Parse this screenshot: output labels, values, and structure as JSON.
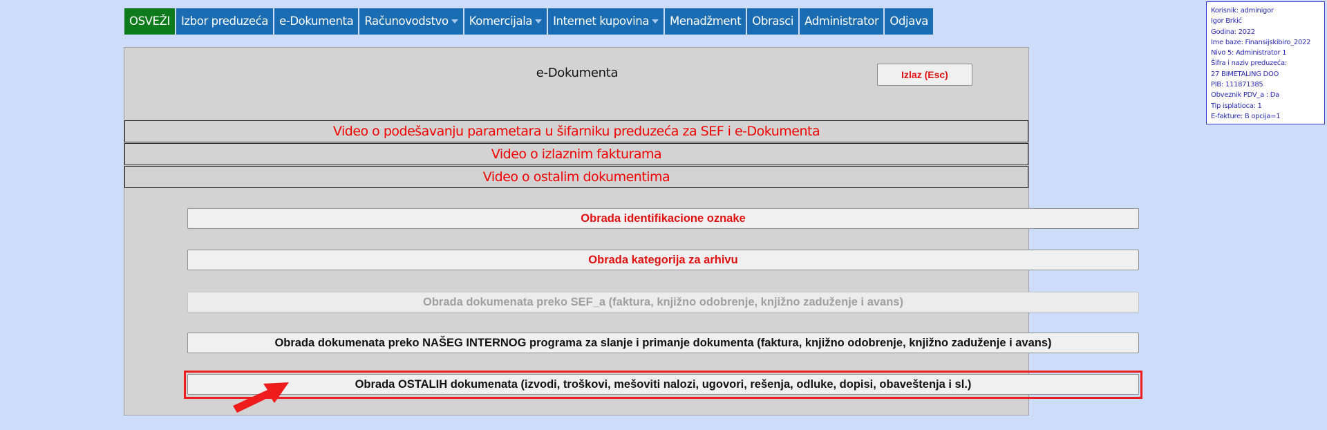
{
  "nav": {
    "items": [
      {
        "label": "OSVEŽI",
        "active": true,
        "dropdown": false
      },
      {
        "label": "Izbor preduzeća",
        "active": false,
        "dropdown": false
      },
      {
        "label": "e-Dokumenta",
        "active": false,
        "dropdown": false
      },
      {
        "label": "Računovodstvo",
        "active": false,
        "dropdown": true
      },
      {
        "label": "Komercijala",
        "active": false,
        "dropdown": true
      },
      {
        "label": "Internet kupovina",
        "active": false,
        "dropdown": true
      },
      {
        "label": "Menadžment",
        "active": false,
        "dropdown": false
      },
      {
        "label": "Obrasci",
        "active": false,
        "dropdown": false
      },
      {
        "label": "Administrator",
        "active": false,
        "dropdown": false
      },
      {
        "label": "Odjava",
        "active": false,
        "dropdown": false
      }
    ]
  },
  "user_info": {
    "lines": [
      "Korisnik: adminigor",
      "Igor Brkić",
      "Godina: 2022",
      "Ime baze: Finansijskibiro_2022",
      "Nivo 5: Administrator 1",
      "Šifra i naziv preduzeća:",
      "27 BIMETALING DOO",
      "PIB: 111871385",
      "Obveznik PDV_a : Da",
      "Tip isplatioca: 1",
      "E-fakture: B opcija=1"
    ]
  },
  "panel": {
    "title": "e-Dokumenta",
    "exit_label": "Izlaz (Esc)"
  },
  "video_links": [
    "Video o podešavanju parametara u šifarniku preduzeća za SEF i e-Dokumenta",
    "Video o izlaznim fakturama",
    "Video o ostalim dokumentima"
  ],
  "actions": [
    {
      "label": "Obrada identifikacione oznake",
      "enabled": true
    },
    {
      "label": "Obrada kategorija za arhivu",
      "enabled": true
    },
    {
      "label": "Obrada dokumenata preko SEF_a (faktura, knjižno odobrenje, knjižno zaduženje i avans)",
      "enabled": false
    },
    {
      "label": "Obrada dokumenata preko NAŠEG INTERNOG programa za slanje i primanje dokumenta (faktura, knjižno odobrenje, knjižno zaduženje i avans)",
      "enabled": true
    },
    {
      "label": "Obrada OSTALIH dokumenata (izvodi, troškovi, mešoviti nalozi, ugovori, rešenja, odluke, dopisi, obaveštenja i sl.)",
      "enabled": true,
      "highlighted": true
    }
  ],
  "colors": {
    "nav_bg": "#1a6cb3",
    "nav_active_bg": "#0d7a1b",
    "page_bg": "#ccdcf9",
    "panel_bg": "#d3d3d3",
    "accent_red": "#ee1c1c"
  },
  "icons": {
    "dropdown": "caret-down-icon",
    "annotation": "red-arrow-icon"
  }
}
